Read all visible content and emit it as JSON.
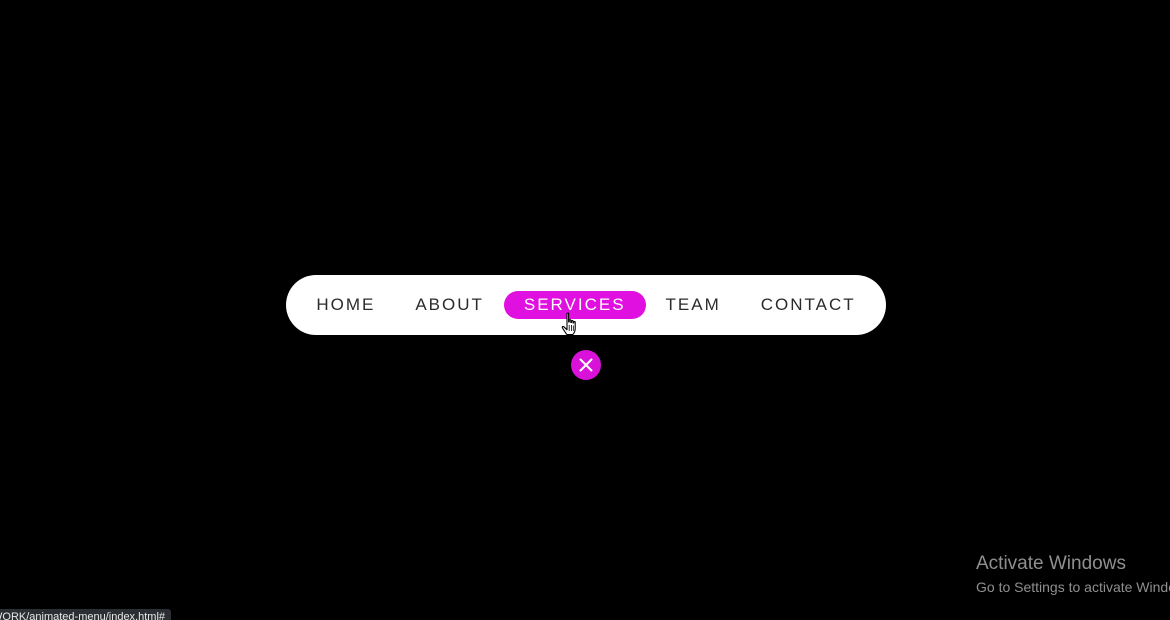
{
  "nav": {
    "items": [
      {
        "label": "HOME",
        "active": false
      },
      {
        "label": "ABOUT",
        "active": false
      },
      {
        "label": "SERVICES",
        "active": true
      },
      {
        "label": "TEAM",
        "active": false
      },
      {
        "label": "CONTACT",
        "active": false
      }
    ],
    "accent_color": "#e010e0"
  },
  "close_button": {
    "icon": "close-icon",
    "color": "#d812d8"
  },
  "cursor": {
    "icon": "hand-pointer-icon"
  },
  "watermark": {
    "title": "Activate Windows",
    "subtitle": "Go to Settings to activate Windows."
  },
  "status_bar": {
    "url": "WORK/animated-menu/index.html#"
  }
}
